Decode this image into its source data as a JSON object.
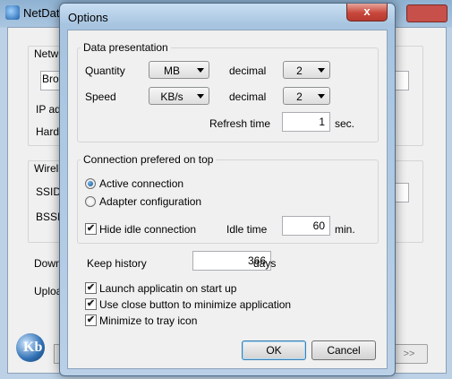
{
  "background_window": {
    "title": "NetDat",
    "labels": [
      "Netwo",
      "Broa",
      "IP ad",
      "Hardv",
      "Wirele",
      "SSID",
      "BSSII",
      "Down",
      "Uploa"
    ],
    "nav_button_label": ">>"
  },
  "dialog": {
    "title": "Options",
    "close_glyph": "x",
    "data_presentation": {
      "group_label": "Data presentation",
      "quantity_label": "Quantity",
      "quantity_unit": "MB",
      "quantity_decimal_label": "decimal",
      "quantity_decimal": "2",
      "speed_label": "Speed",
      "speed_unit": "KB/s",
      "speed_decimal_label": "decimal",
      "speed_decimal": "2",
      "refresh_label": "Refresh time",
      "refresh_value": "1",
      "refresh_unit": "sec."
    },
    "connection": {
      "group_label": "Connection prefered on top",
      "option_active": "Active connection",
      "option_adapter": "Adapter configuration",
      "selected": "active",
      "hide_idle_label": "Hide idle connection",
      "hide_idle_checked": true,
      "idle_time_label": "Idle time",
      "idle_time_value": "60",
      "idle_time_unit": "min."
    },
    "keep_history_label": "Keep history",
    "keep_history_value": "366",
    "keep_history_unit": "days",
    "checkboxes": [
      {
        "label": "Launch applicatin on start up",
        "checked": true
      },
      {
        "label": "Use close button to minimize application",
        "checked": true
      },
      {
        "label": "Minimize to tray icon",
        "checked": true
      }
    ],
    "ok_label": "OK",
    "cancel_label": "Cancel"
  },
  "icons": {
    "check": "✔",
    "app_icon": "network-app-icon",
    "logo": "kb-logo-icon"
  },
  "colors": {
    "dialog_frame": "#b9d0e7",
    "close_button": "#c8473b",
    "client_bg": "#f0f0f0",
    "default_button_border": "#3c7fb1"
  }
}
